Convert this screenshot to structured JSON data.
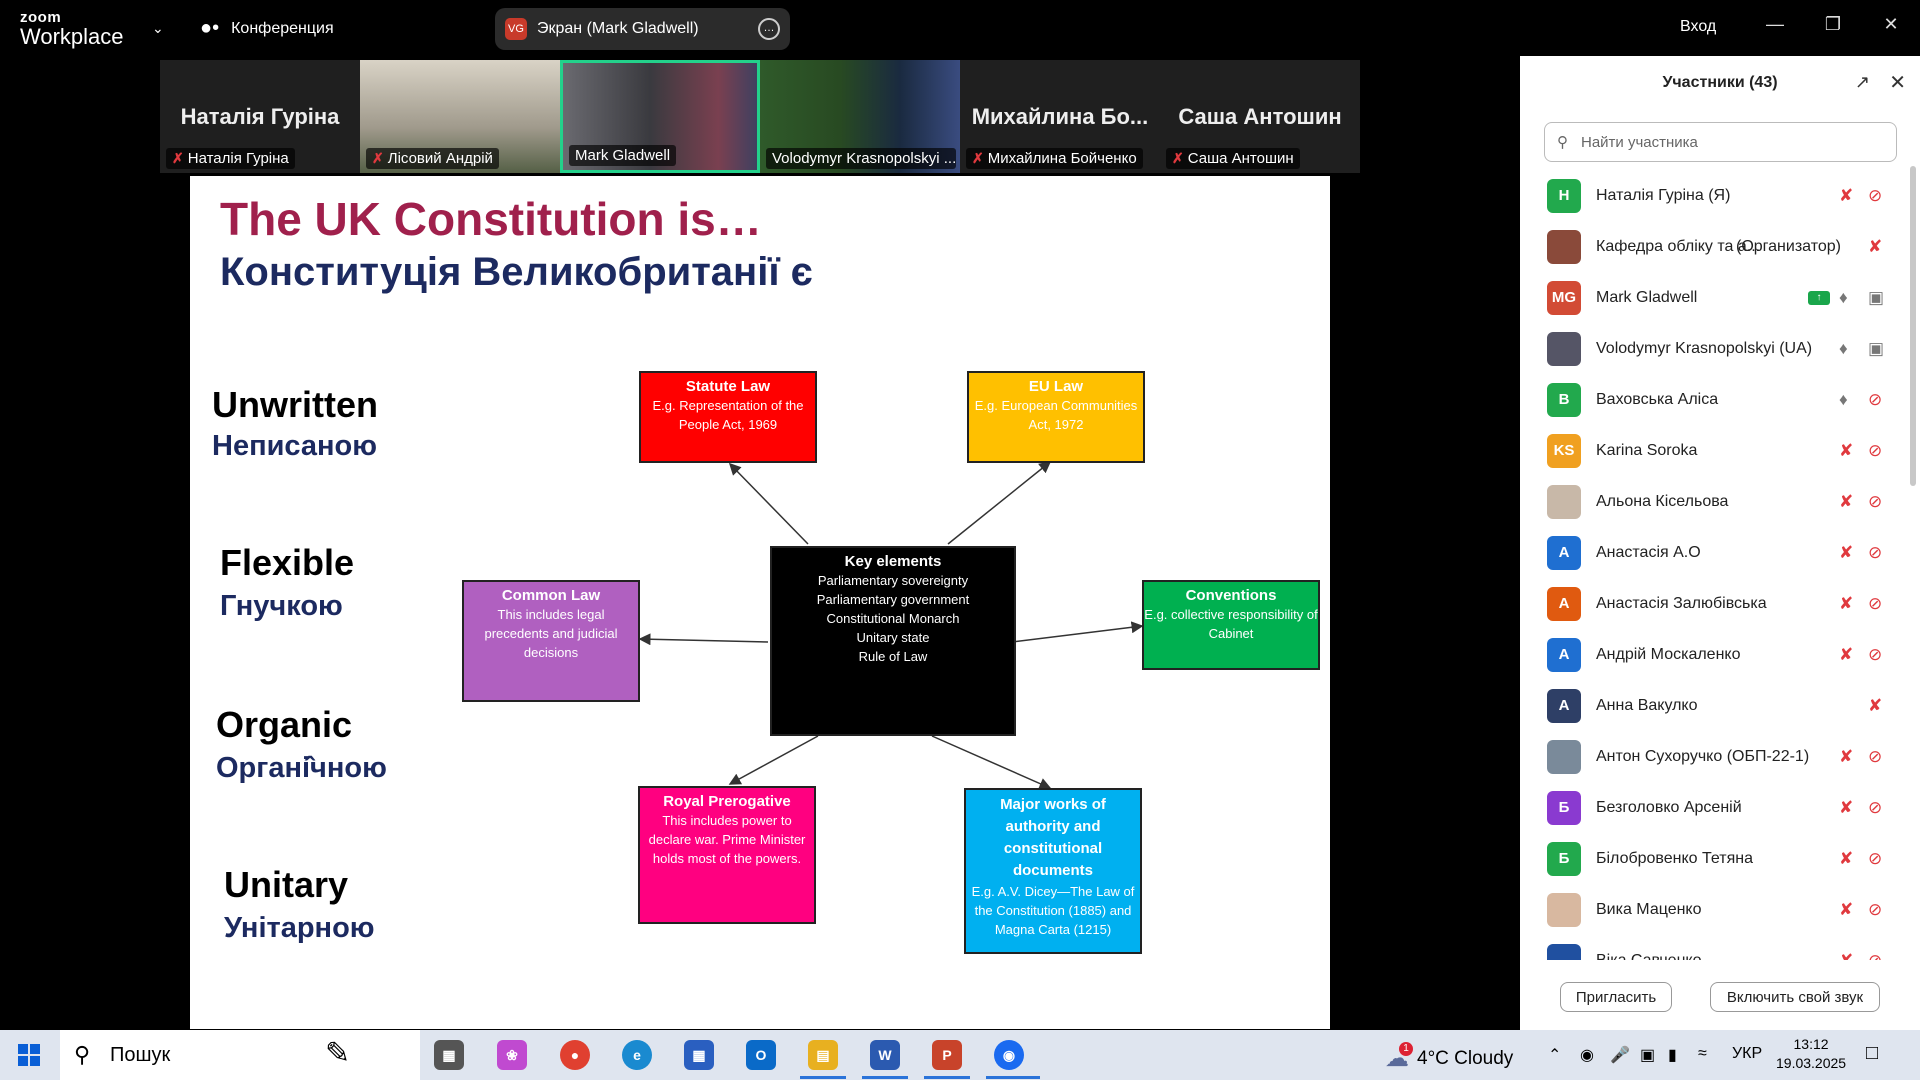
{
  "titlebar": {
    "logo_top": "zoom",
    "logo_bottom": "Workplace",
    "meeting_label": "Конференция",
    "share_badge": "VG",
    "share_label": "Экран (Mark Gladwell)",
    "login_label": "Вход"
  },
  "thumbnails": [
    {
      "big": "Наталія Гуріна",
      "caption": "Наталія Гуріна",
      "muted": true
    },
    {
      "big": "",
      "caption": "Лісовий Андрій",
      "muted": true
    },
    {
      "big": "",
      "caption": "Mark Gladwell",
      "muted": false
    },
    {
      "big": "",
      "caption": "Volodymyr Krasnopolskyi ...",
      "muted": false
    },
    {
      "big": "Михайлина Бо...",
      "caption": "Михайлина Бойченко",
      "muted": true
    },
    {
      "big": "Саша Антошин",
      "caption": "Саша Антошин",
      "muted": true
    }
  ],
  "slide": {
    "title_en": "The UK Constitution is…",
    "title_ua": "Конституція Великобританії є",
    "labels": [
      {
        "en": "Unwritten",
        "ua": "Неписаною"
      },
      {
        "en": "Flexible",
        "ua": "Гнучкою"
      },
      {
        "en": "Organic",
        "ua": "Органі̂чною"
      },
      {
        "en": "Unitary",
        "ua": "Унітарною"
      }
    ],
    "boxes": {
      "statute": {
        "title": "Statute Law",
        "desc": "E.g. Representation of the People Act, 1969",
        "color": "#ff0000"
      },
      "eu": {
        "title": "EU Law",
        "desc": "E.g. European Communities Act, 1972",
        "color": "#ffc000"
      },
      "key": {
        "title": "Key elements",
        "desc": [
          "Parliamentary sovereignty",
          "Parliamentary government",
          "Constitutional Monarch",
          "Unitary state",
          "Rule of Law"
        ],
        "color": "#000000"
      },
      "common": {
        "title": "Common Law",
        "desc": "This includes legal precedents and judicial decisions",
        "color": "#b060c0"
      },
      "conventions": {
        "title": "Conventions",
        "desc": "E.g. collective responsibility of Cabinet",
        "color": "#00b050"
      },
      "royal": {
        "title": "Royal Prerogative",
        "desc": "This includes power to declare war. Prime Minister holds most of the powers.",
        "color": "#ff0080"
      },
      "major": {
        "title": "Major works of authority and constitutional documents",
        "desc": "E.g. A.V. Dicey—The Law of the Constitution (1885) and Magna Carta (1215)",
        "color": "#00b0f0"
      }
    }
  },
  "participants_panel": {
    "title": "Участники (43)",
    "search_placeholder": "Найти участника",
    "participants": [
      {
        "initials": "Н",
        "name": "Наталія Гуріна (Я)",
        "role": "",
        "color": "#22a94d",
        "mic": "muted",
        "cam": "off"
      },
      {
        "initials": "",
        "name": "Кафедра обліку та а...",
        "role": "(Организатор)",
        "color": "#8a4a3a",
        "mic": "muted",
        "cam": "none"
      },
      {
        "initials": "MG",
        "name": "Mark Gladwell",
        "role": "",
        "color": "#d24b35",
        "mic": "on",
        "cam": "on",
        "sharing": true
      },
      {
        "initials": "",
        "name": "Volodymyr Krasnopolskyi (UA)",
        "role": "",
        "color": "#555566",
        "mic": "on",
        "cam": "on"
      },
      {
        "initials": "В",
        "name": "Ваховська Аліса",
        "role": "",
        "color": "#22a94d",
        "mic": "on",
        "cam": "off"
      },
      {
        "initials": "KS",
        "name": "Karina Soroka",
        "role": "",
        "color": "#f0a020",
        "mic": "muted",
        "cam": "off"
      },
      {
        "initials": "",
        "name": "Альона Кісельова",
        "role": "",
        "color": "#c8b8a8",
        "mic": "muted",
        "cam": "off"
      },
      {
        "initials": "А",
        "name": "Анастасія А.О",
        "role": "",
        "color": "#1f6fd1",
        "mic": "muted",
        "cam": "off"
      },
      {
        "initials": "А",
        "name": "Анастасія Залюбівська",
        "role": "",
        "color": "#e05a10",
        "mic": "muted",
        "cam": "off"
      },
      {
        "initials": "А",
        "name": "Андрій Москаленко",
        "role": "",
        "color": "#1f6fd1",
        "mic": "muted",
        "cam": "off"
      },
      {
        "initials": "А",
        "name": "Анна Вакулко",
        "role": "",
        "color": "#2e3f66",
        "mic": "muted",
        "cam": "none"
      },
      {
        "initials": "",
        "name": "Антон Сухоручко (ОБП-22-1)",
        "role": "",
        "color": "#7a8a9a",
        "mic": "muted",
        "cam": "off"
      },
      {
        "initials": "Б",
        "name": "Безголовко Арсеній",
        "role": "",
        "color": "#8a3ad0",
        "mic": "muted",
        "cam": "off"
      },
      {
        "initials": "Б",
        "name": "Білобровенко Тетяна",
        "role": "",
        "color": "#22a94d",
        "mic": "muted",
        "cam": "off"
      },
      {
        "initials": "",
        "name": "Вика Маценко",
        "role": "",
        "color": "#d8b8a0",
        "mic": "muted",
        "cam": "off"
      },
      {
        "initials": "",
        "name": "Віка Савченко",
        "role": "",
        "color": "#2050a0",
        "mic": "muted",
        "cam": "off"
      }
    ],
    "invite_label": "Пригласить",
    "unmute_label": "Включить свой звук"
  },
  "taskbar": {
    "search_label": "Пошук",
    "weather_badge": "1",
    "weather": "4°C  Cloudy",
    "language": "УКР",
    "time": "13:12",
    "date": "19.03.2025"
  }
}
